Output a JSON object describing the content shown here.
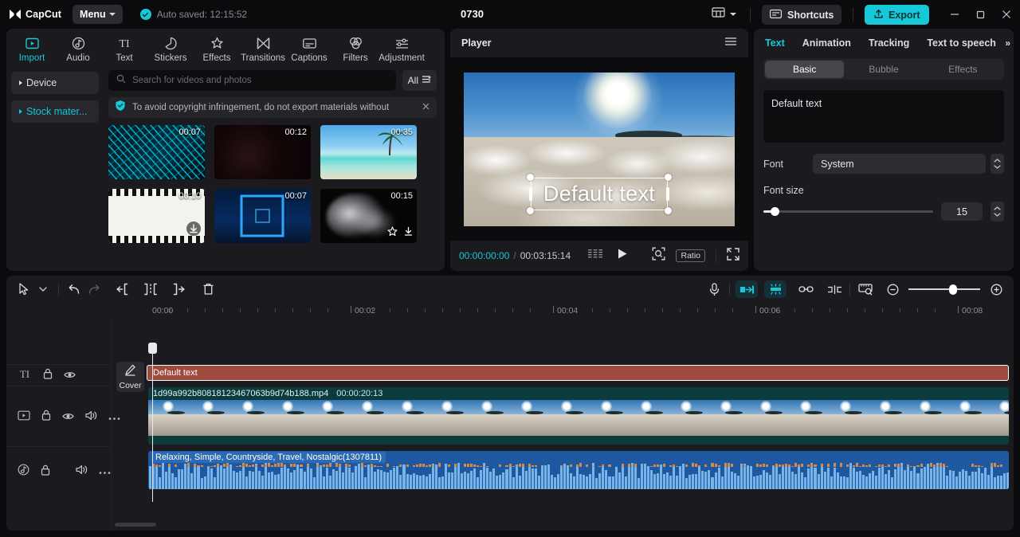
{
  "app": {
    "brand": "CapCut",
    "menu_label": "Menu",
    "autosave_text": "Auto saved: 12:15:52",
    "project_title": "0730",
    "shortcuts_label": "Shortcuts",
    "export_label": "Export",
    "accent_color": "#16c8d8"
  },
  "tabs": [
    {
      "label": "Import",
      "icon": "import-icon",
      "active": true
    },
    {
      "label": "Audio",
      "icon": "audio-icon",
      "active": false
    },
    {
      "label": "Text",
      "icon": "text-icon",
      "active": false
    },
    {
      "label": "Stickers",
      "icon": "stickers-icon",
      "active": false
    },
    {
      "label": "Effects",
      "icon": "effects-icon",
      "active": false
    },
    {
      "label": "Transitions",
      "icon": "transitions-icon",
      "active": false
    },
    {
      "label": "Captions",
      "icon": "captions-icon",
      "active": false
    },
    {
      "label": "Filters",
      "icon": "filters-icon",
      "active": false
    },
    {
      "label": "Adjustment",
      "icon": "adjustment-icon",
      "active": false
    }
  ],
  "media": {
    "sidebar": [
      {
        "label": "Device",
        "active": false
      },
      {
        "label": "Stock mater...",
        "active": true
      }
    ],
    "search_placeholder": "Search for videos and photos",
    "filter_label": "All",
    "notice_text": "To avoid copyright infringement, do not export materials without",
    "thumbnails": [
      {
        "duration": "00:07",
        "art": "circuit",
        "selected": false
      },
      {
        "duration": "00:12",
        "art": "dark",
        "selected": false
      },
      {
        "duration": "00:35",
        "art": "beach",
        "selected": false
      },
      {
        "duration": "00:10",
        "art": "film",
        "selected": false
      },
      {
        "duration": "00:07",
        "art": "neon",
        "selected": true
      },
      {
        "duration": "00:15",
        "art": "smoke",
        "selected": false
      }
    ]
  },
  "player": {
    "title": "Player",
    "overlay_text": "Default text",
    "current_time": "00:00:00:00",
    "time_separator": "/",
    "total_time": "00:03:15:14",
    "ratio_label": "Ratio"
  },
  "props": {
    "tabs": [
      {
        "label": "Text",
        "active": true
      },
      {
        "label": "Animation",
        "active": false
      },
      {
        "label": "Tracking",
        "active": false
      },
      {
        "label": "Text to speech",
        "active": false
      }
    ],
    "overflow_label": "»",
    "segments": [
      {
        "label": "Basic",
        "active": true
      },
      {
        "label": "Bubble",
        "active": false
      },
      {
        "label": "Effects",
        "active": false
      }
    ],
    "text_value": "Default text",
    "font_label": "Font",
    "font_value": "System",
    "font_size_label": "Font size",
    "font_size_value": "15",
    "font_size_percent": 5
  },
  "timeline": {
    "ruler_labels": [
      "00:00",
      "00:02",
      "00:04",
      "00:06",
      "00:08"
    ],
    "text_clip": {
      "label": "Default text"
    },
    "video_clip": {
      "name": "1d99a992b80818123467063b9d74b188.mp4",
      "duration": "00:00:20:13"
    },
    "audio_clip": {
      "name": "Relaxing, Simple, Countryside, Travel, Nostalgic(1307811)"
    },
    "cover_label": "Cover",
    "tracks": [
      {
        "icon": "text-track-icon"
      },
      {
        "icon": "video-track-icon"
      },
      {
        "icon": "audio-track-icon"
      }
    ]
  }
}
